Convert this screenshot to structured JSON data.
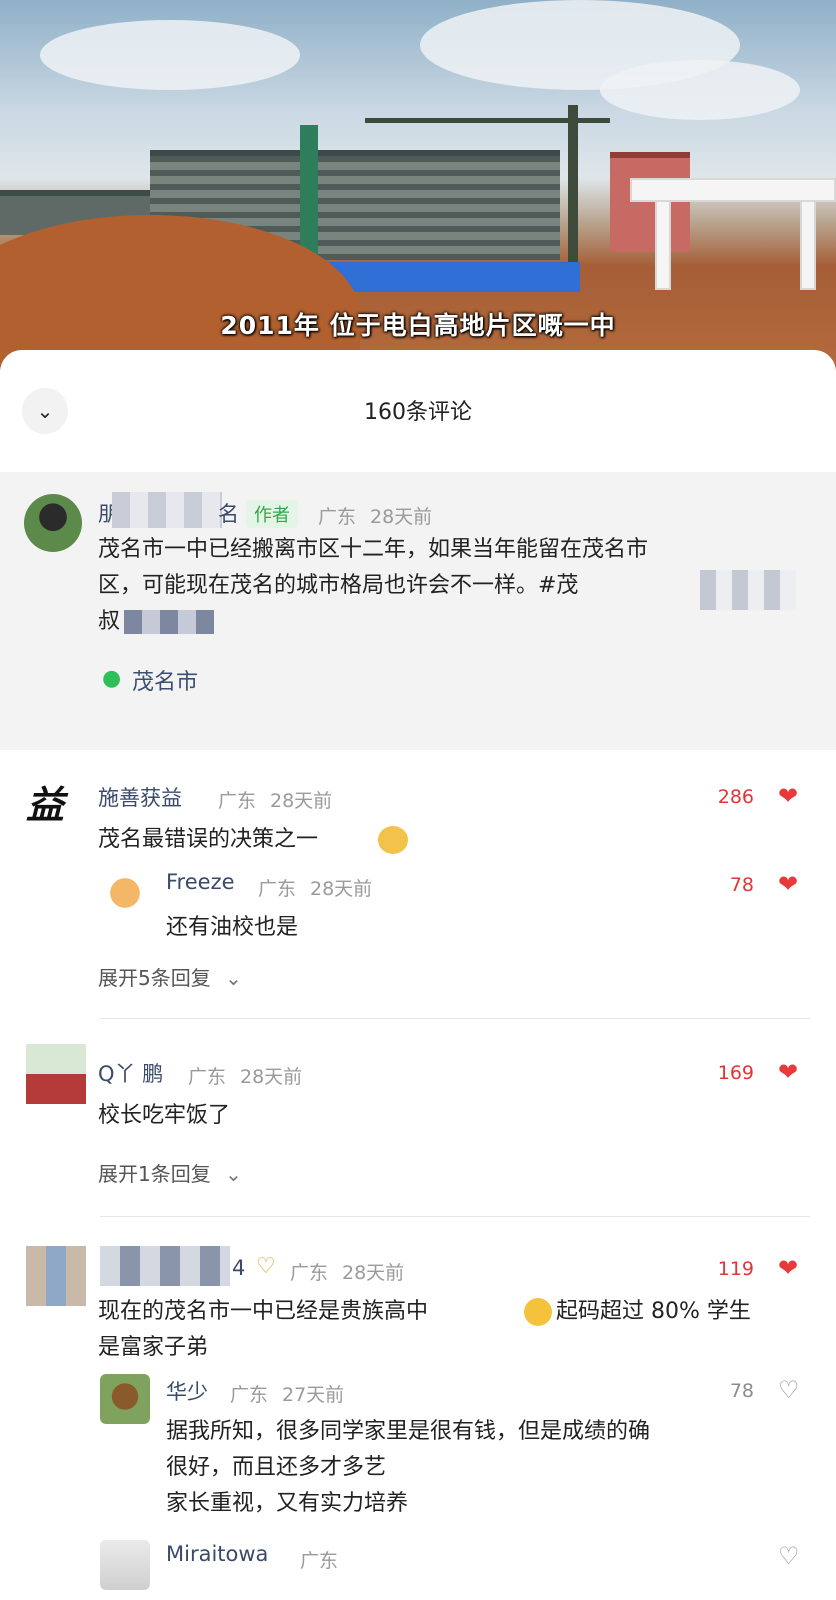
{
  "video": {
    "caption": "2011年 位于电白高地片区嘅一中"
  },
  "sheet": {
    "title": "160条评论",
    "collapse_icon": "chevron-down-icon"
  },
  "author_comment": {
    "name_visible": "朋",
    "name_tail": "名",
    "badge": "作者",
    "region": "广东",
    "time": "28天前",
    "text_line1": "茂名市一中已经搬离市区十二年，如果当年能留在茂名市",
    "text_line2": "区，可能现在茂名的城市格局也许会不一样。#茂",
    "text_line3": "叔",
    "location": "茂名市"
  },
  "comments": [
    {
      "user": "施善获益",
      "region": "广东",
      "time": "28天前",
      "likes": "286",
      "text": "茂名最错误的决策之一",
      "reply": {
        "user": "Freeze",
        "region": "广东",
        "time": "28天前",
        "likes": "78",
        "text": "还有油校也是"
      },
      "expand": "展开5条回复"
    },
    {
      "user": "Q丫 鹏",
      "region": "广东",
      "time": "28天前",
      "likes": "169",
      "text": "校长吃牢饭了",
      "expand": "展开1条回复"
    },
    {
      "user_tail": "4",
      "region": "广东",
      "time": "28天前",
      "likes": "119",
      "text_line1": "现在的茂名市一中已经是贵族高中",
      "text_line1b": "起码超过 80% 学生",
      "text_line2": "是富家子弟",
      "replies": [
        {
          "user": "华少",
          "region": "广东",
          "time": "27天前",
          "likes": "78",
          "text_line1": "据我所知，很多同学家里是很有钱，但是成绩的确",
          "text_line2": "很好，而且还多才多艺",
          "text_line3": "家长重视，又有实力培养"
        },
        {
          "user": "Miraitowa",
          "region": "广东"
        }
      ]
    }
  ],
  "colors": {
    "like_red": "#e83a3a",
    "name_blue": "#3a4a6b",
    "author_badge_green": "#2fa84f"
  }
}
